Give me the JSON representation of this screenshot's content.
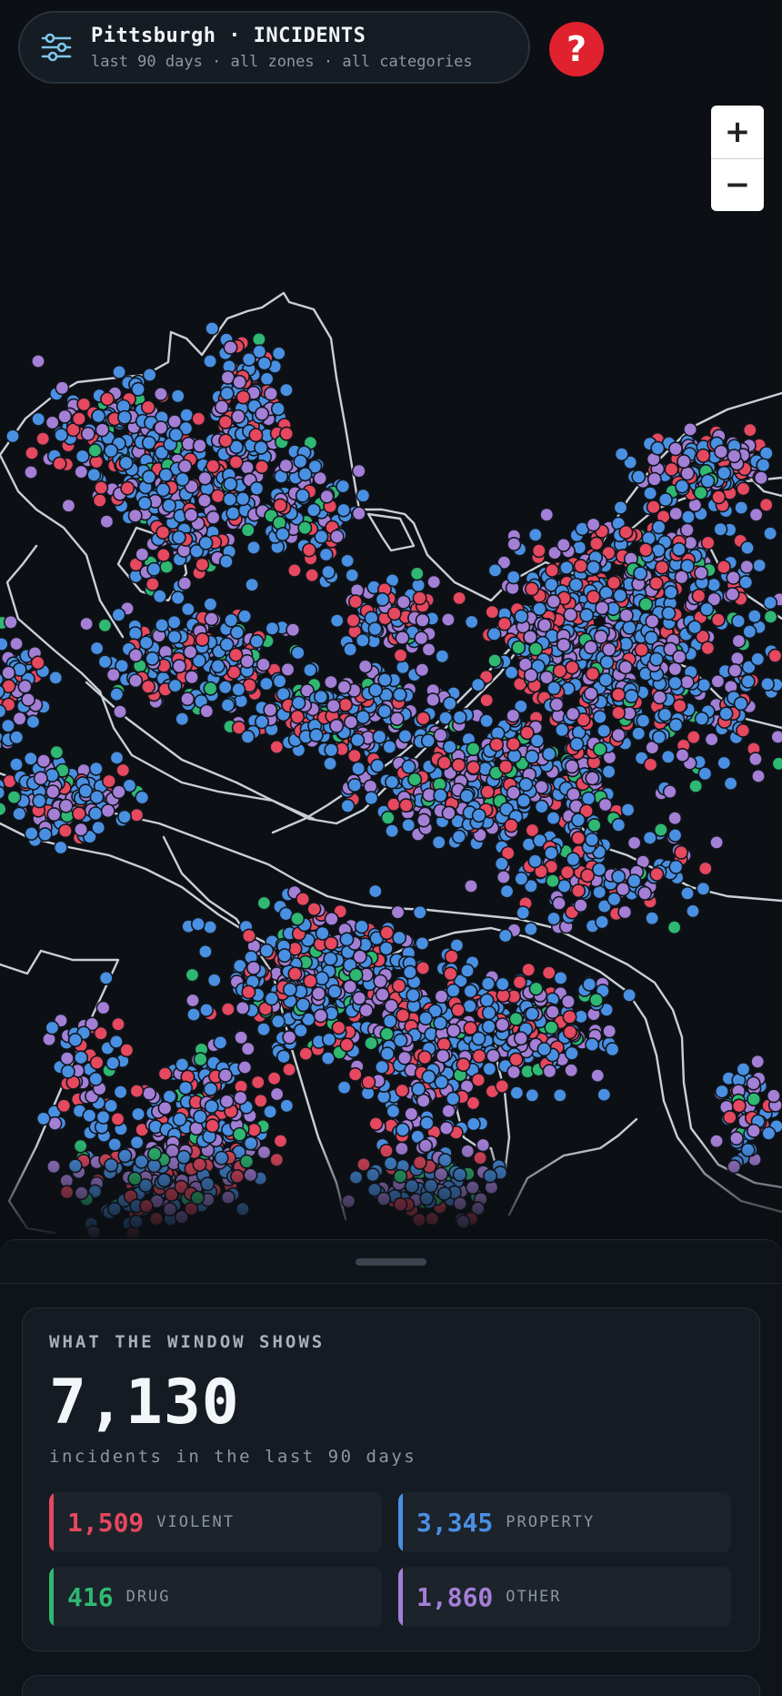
{
  "header": {
    "title": "Pittsburgh · INCIDENTS",
    "subtitle": "last 90 days · all zones · all categories",
    "filter_icon": "sliders-icon",
    "help_label": "?",
    "help_icon": "question-icon"
  },
  "zoom": {
    "in_label": "+",
    "out_label": "−"
  },
  "summary": {
    "label": "WHAT THE WINDOW SHOWS",
    "total": "7,130",
    "caption": "incidents in the last 90 days",
    "categories": [
      {
        "count": "1,509",
        "name": "VIOLENT",
        "color": "#e5485f"
      },
      {
        "count": "3,345",
        "name": "PROPERTY",
        "color": "#4a90e2"
      },
      {
        "count": "416",
        "name": "DRUG",
        "color": "#2fb872"
      },
      {
        "count": "1,860",
        "name": "OTHER",
        "color": "#a47fd6"
      }
    ]
  },
  "colors": {
    "background": "#0b0f14",
    "boundary": "#c9cfd6",
    "accent_help": "#e0212e",
    "filter_icon": "#7cc6ea"
  }
}
